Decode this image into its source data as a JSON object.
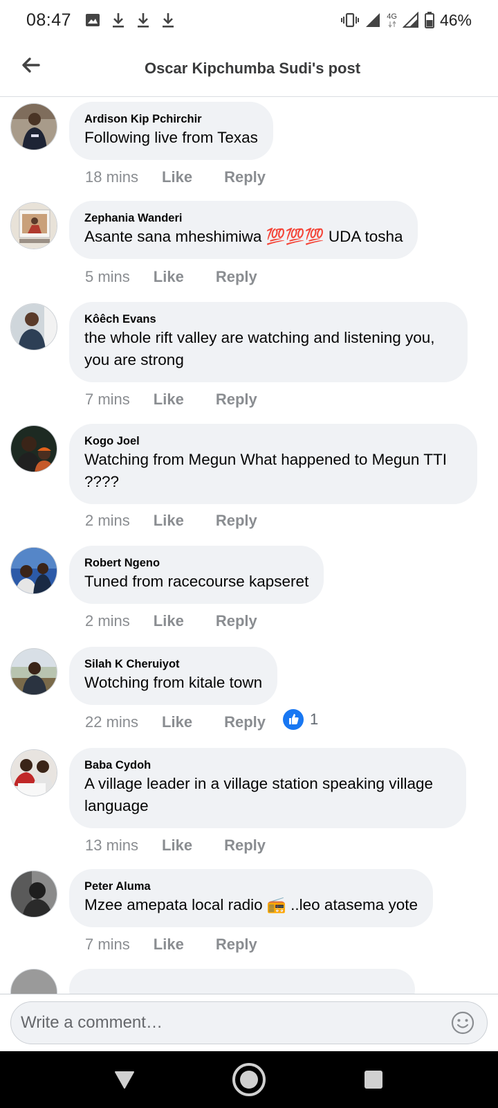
{
  "status_bar": {
    "time": "08:47",
    "left_icons": [
      "image-icon",
      "download-icon",
      "download-icon",
      "download-icon"
    ],
    "right_icons": [
      "vibrate-icon",
      "signal-icon",
      "4g-icon",
      "signal-icon",
      "battery-icon"
    ],
    "network": "4G",
    "battery": "46%"
  },
  "header": {
    "title": "Oscar Kipchumba Sudi's post",
    "back_icon": "back-arrow-icon"
  },
  "comments": [
    {
      "author": "Ardison Kip Pchirchir",
      "text": "Following live from Texas",
      "time": "18 mins",
      "like": "Like",
      "reply": "Reply"
    },
    {
      "author": "Zephania Wanderi",
      "text": "Asante sana mheshimiwa 💯💯💯 UDA tosha",
      "time": "5 mins",
      "like": "Like",
      "reply": "Reply"
    },
    {
      "author": "Kôêch Evans",
      "text": "the whole rift valley are watching and listening you, you are strong",
      "time": "7 mins",
      "like": "Like",
      "reply": "Reply"
    },
    {
      "author": "Kogo Joel",
      "text": "Watching from Megun What happened to Megun TTI ????",
      "time": "2 mins",
      "like": "Like",
      "reply": "Reply"
    },
    {
      "author": "Robert Ngeno",
      "text": "Tuned from racecourse kapseret",
      "time": "2 mins",
      "like": "Like",
      "reply": "Reply"
    },
    {
      "author": "Silah K Cheruiyot",
      "text": "Wotching from kitale town",
      "time": "22 mins",
      "like": "Like",
      "reply": "Reply",
      "reaction_count": "1"
    },
    {
      "author": "Baba Cydoh",
      "text": "A village leader in a village station speaking village language",
      "time": "13 mins",
      "like": "Like",
      "reply": "Reply"
    },
    {
      "author": "Peter Aluma",
      "text": "Mzee amepata local radio 📻 ..leo atasema yote",
      "time": "7 mins",
      "like": "Like",
      "reply": "Reply"
    }
  ],
  "composer": {
    "placeholder": "Write a comment…",
    "emoji_icon": "smiley-icon"
  },
  "nav_bar": {
    "buttons": [
      "back-triangle-icon",
      "home-circle-icon",
      "recents-square-icon"
    ]
  }
}
